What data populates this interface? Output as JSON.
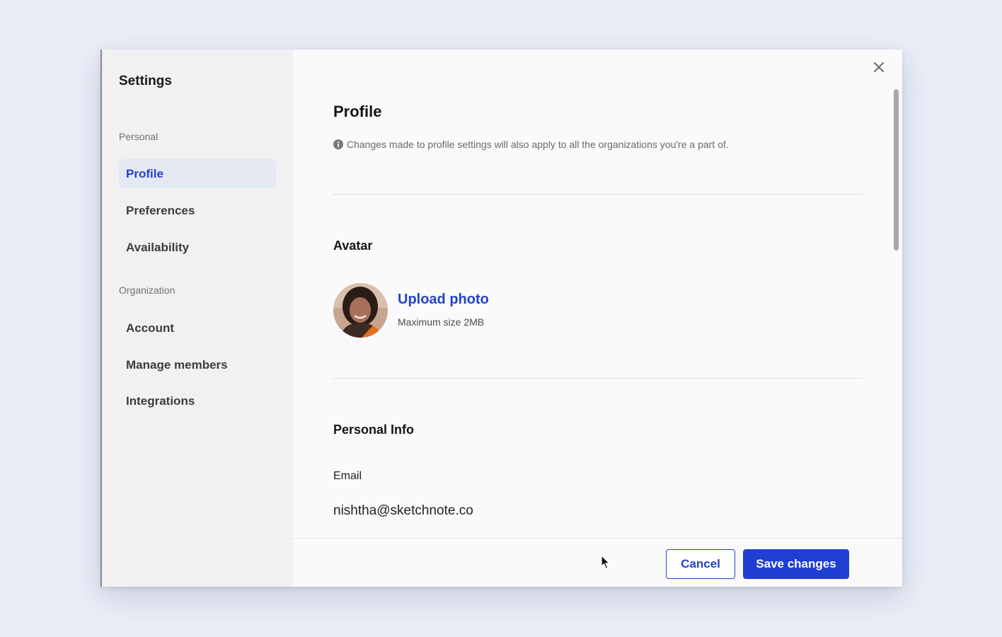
{
  "sidebar": {
    "title": "Settings",
    "sections": [
      {
        "label": "Personal",
        "items": [
          {
            "label": "Profile",
            "active": true
          },
          {
            "label": "Preferences",
            "active": false
          },
          {
            "label": "Availability",
            "active": false
          }
        ]
      },
      {
        "label": "Organization",
        "items": [
          {
            "label": "Account",
            "active": false
          },
          {
            "label": "Manage members",
            "active": false
          },
          {
            "label": "Integrations",
            "active": false
          }
        ]
      }
    ]
  },
  "main": {
    "title": "Profile",
    "notice": "Changes made to profile settings will also apply to all the organizations you're a part of.",
    "notice_icon": "info-icon",
    "avatar_section": {
      "title": "Avatar",
      "upload_label": "Upload photo",
      "hint": "Maximum size 2MB"
    },
    "personal_info": {
      "title": "Personal Info",
      "email_label": "Email",
      "email_value": "nishtha@sketchnote.co"
    }
  },
  "footer": {
    "cancel_label": "Cancel",
    "save_label": "Save changes"
  },
  "colors": {
    "accent": "#2343c8",
    "primary_button": "#1f3fd3",
    "sidebar_bg": "#f1f1f1",
    "active_item_bg": "#e4e8f3",
    "page_bg": "#e9eef8"
  },
  "icons": {
    "close": "close-icon",
    "info": "info-icon",
    "cursor": "mouse-pointer-icon"
  }
}
